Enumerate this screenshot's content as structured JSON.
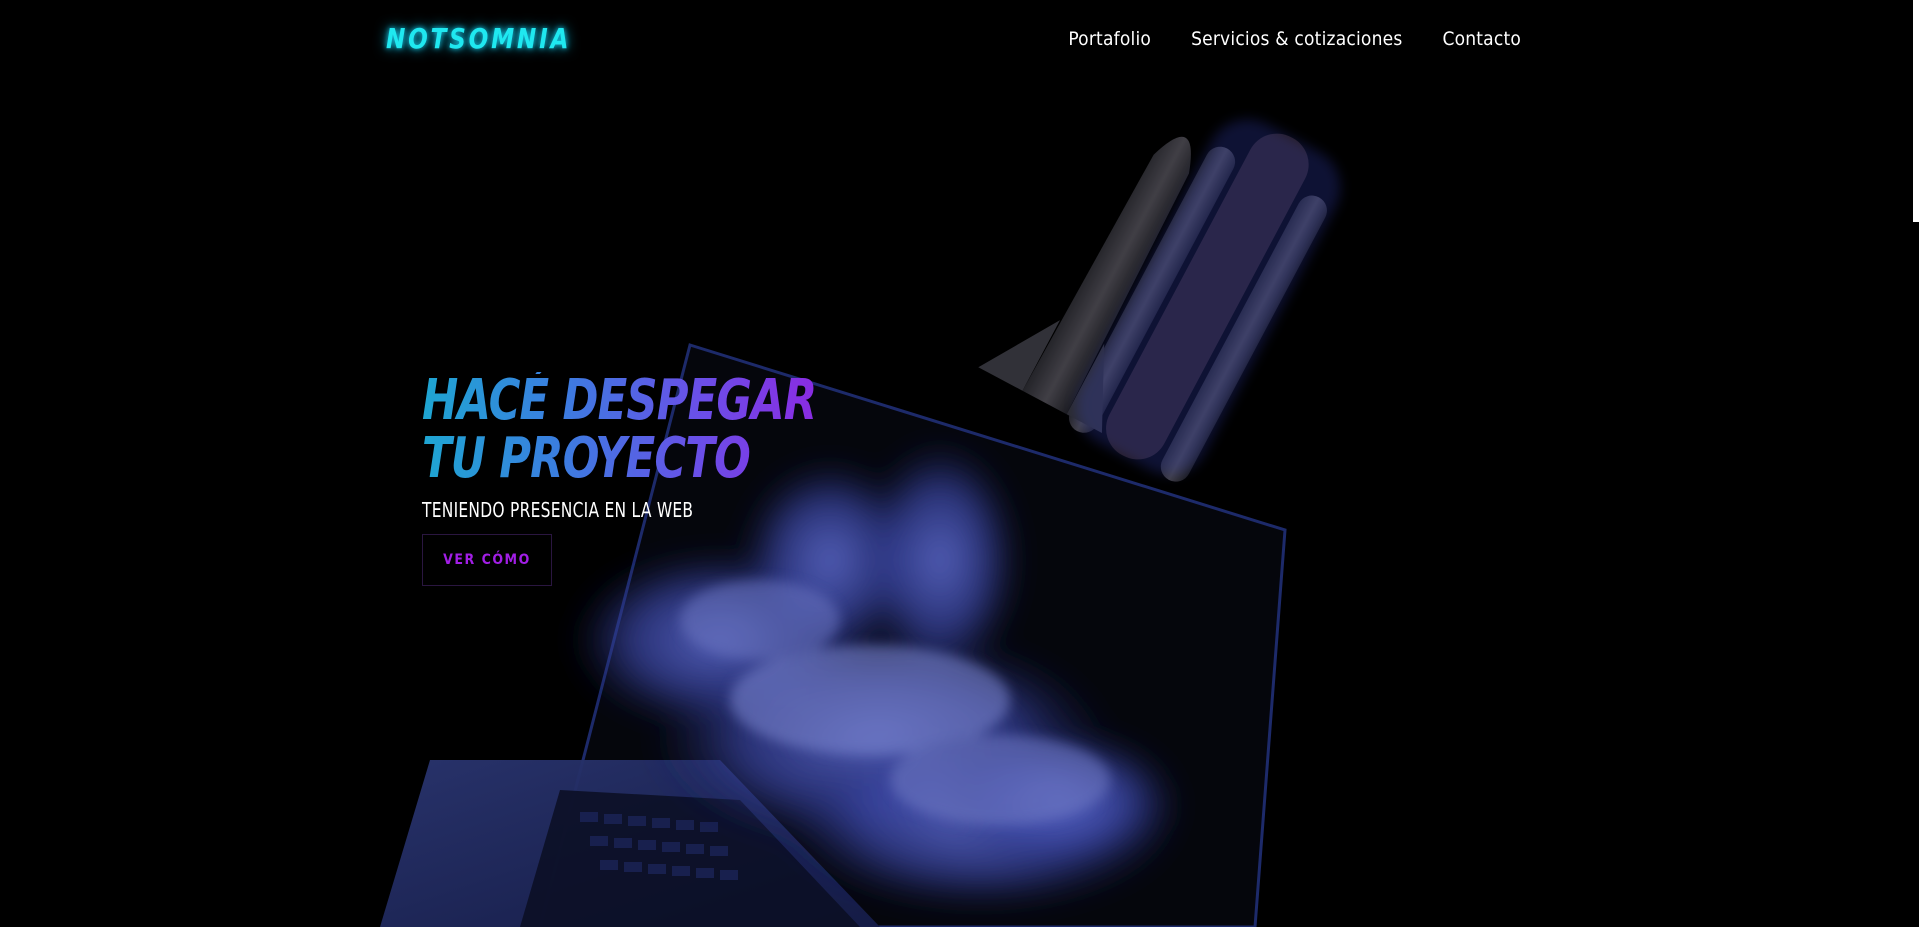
{
  "brand": {
    "logo_text": "NOTSOMNIA"
  },
  "nav": {
    "items": [
      {
        "label": "Portafolio"
      },
      {
        "label": "Servicios & cotizaciones"
      },
      {
        "label": "Contacto"
      }
    ]
  },
  "hero": {
    "headline": "HACÉ DESPEGAR TU PROYECTO",
    "subheadline": "TENIENDO PRESENCIA EN LA WEB",
    "cta_label": "VER CÓMO"
  },
  "colors": {
    "background": "#000000",
    "logo": "#1fe8f0",
    "headline_start": "#1ea6d2",
    "headline_end": "#8a2be2",
    "cta_text": "#a21ee6"
  },
  "icons": {
    "hero_image": "rocket-launching-from-laptop-illustration"
  }
}
